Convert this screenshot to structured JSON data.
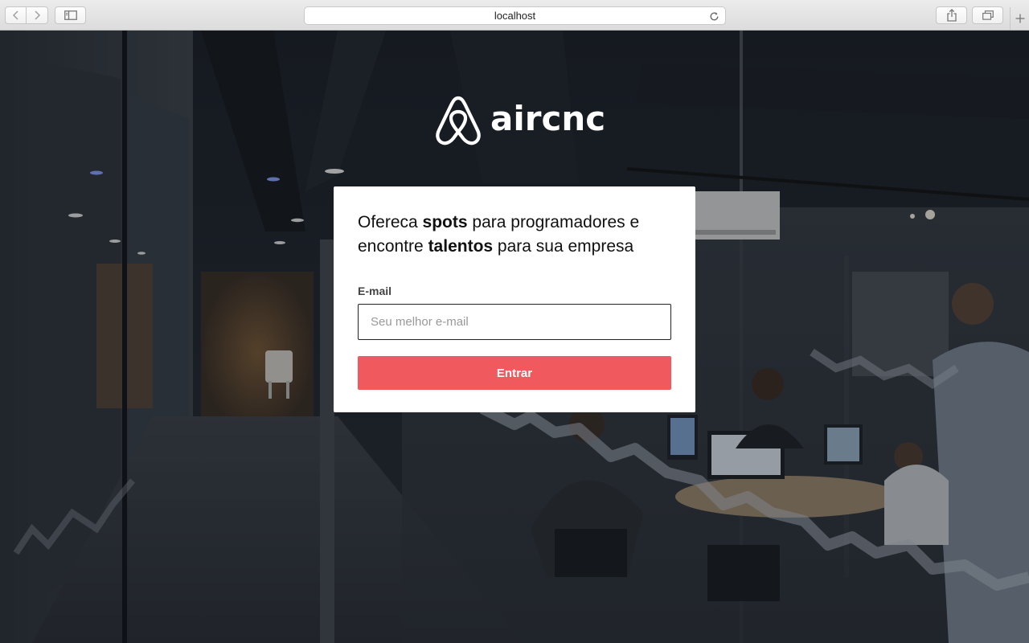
{
  "browser": {
    "address": "localhost",
    "icons": {
      "back": "chevron-left-icon",
      "forward": "chevron-right-icon",
      "sidebar": "sidebar-icon",
      "reload": "reload-icon",
      "share": "share-icon",
      "tabs": "tabs-overview-icon",
      "new_tab": "plus-icon"
    }
  },
  "brand": {
    "name": "aircnc",
    "logo_icon": "airbnb-belo-icon"
  },
  "hero": {
    "headline_part1": "Ofereca ",
    "headline_bold1": "spots",
    "headline_part2": " para programadores e encontre ",
    "headline_bold2": "talentos",
    "headline_part3": " para sua empresa"
  },
  "form": {
    "email_label": "E-mail",
    "email_value": "",
    "email_placeholder": "Seu melhor e-mail",
    "submit_label": "Entrar"
  },
  "colors": {
    "accent": "#f05a5f",
    "card_background": "#ffffff",
    "toolbar": "#e3e3e3"
  }
}
